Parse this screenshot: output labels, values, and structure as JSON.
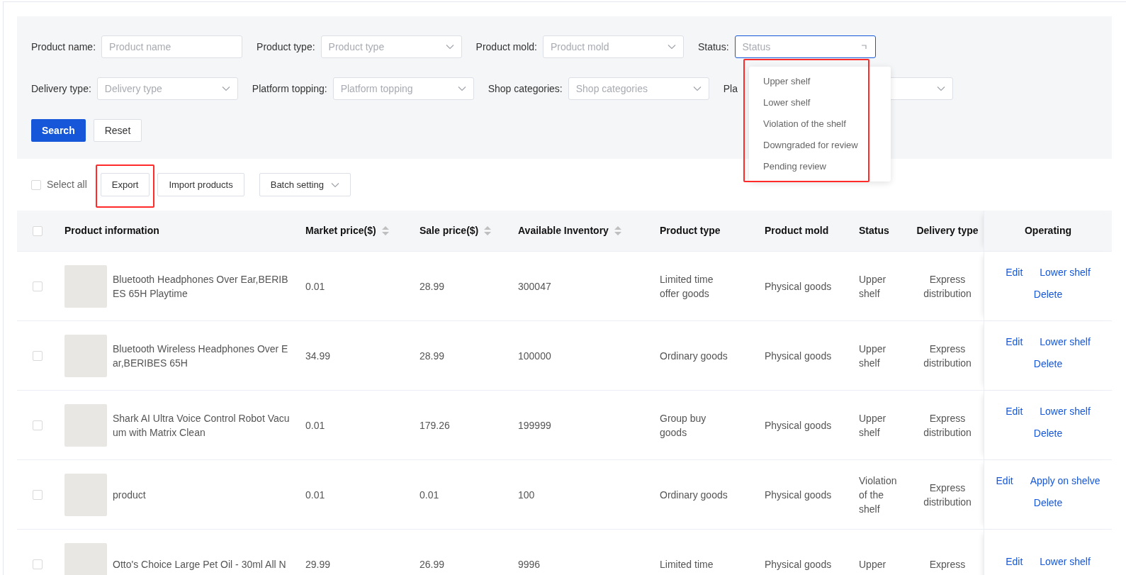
{
  "filters": [
    {
      "kind": "input",
      "label": "Product name:",
      "placeholder": "Product name",
      "focused": false
    },
    {
      "kind": "select",
      "label": "Product type:",
      "placeholder": "Product type",
      "focused": false
    },
    {
      "kind": "select",
      "label": "Product mold:",
      "placeholder": "Product mold",
      "focused": false
    },
    {
      "kind": "select",
      "label": "Status:",
      "placeholder": "Status",
      "focused": true
    },
    {
      "kind": "select",
      "label": "Delivery type:",
      "placeholder": "Delivery type",
      "focused": false
    },
    {
      "kind": "select",
      "label": "Platform topping:",
      "placeholder": "Platform topping",
      "focused": false
    },
    {
      "kind": "select",
      "label": "Shop categories:",
      "placeholder": "Shop categories",
      "focused": false
    },
    {
      "kind": "select",
      "label": "Pla",
      "focused": false
    }
  ],
  "filter_buttons": [
    {
      "label": "Search",
      "kind": "primary"
    },
    {
      "label": "Reset",
      "kind": "default"
    }
  ],
  "status_dropdown": {
    "highlighted": true,
    "options": [
      "Upper shelf",
      "Lower shelf",
      "Violation of the shelf",
      "Downgraded for review",
      "Pending review"
    ]
  },
  "toolbar": {
    "select_all": {
      "label": "Select all",
      "checked": false
    },
    "buttons": [
      {
        "label": "Export",
        "kind": "button",
        "highlighted": true
      },
      {
        "label": "Import products",
        "kind": "button",
        "highlighted": false
      },
      {
        "label": "Batch setting",
        "kind": "menu",
        "highlighted": false
      }
    ]
  },
  "table": {
    "header_checked": false,
    "columns": [
      {
        "label": "Product information",
        "sortable": false
      },
      {
        "label": "Market price($)",
        "sortable": true
      },
      {
        "label": "Sale price($)",
        "sortable": true
      },
      {
        "label": "Available Inventory",
        "sortable": true
      },
      {
        "label": "Product type",
        "sortable": false
      },
      {
        "label": "Product mold",
        "sortable": false
      },
      {
        "label": "Status",
        "sortable": false
      },
      {
        "label": "Delivery type",
        "sortable": false
      },
      {
        "label": "Operating",
        "sortable": false
      }
    ],
    "rows": [
      {
        "checked": false,
        "name": "Bluetooth Headphones Over Ear,BERIBES 65H Playtime",
        "market_price": "0.01",
        "sale_price": "28.99",
        "inventory": "300047",
        "product_type": "Limited time offer goods",
        "product_mold": "Physical goods",
        "status": "Upper shelf",
        "delivery_type": "Express distribution",
        "actions": [
          "Edit",
          "Lower shelf",
          "Delete"
        ]
      },
      {
        "checked": false,
        "name": "Bluetooth Wireless Headphones Over Ear,BERIBES 65H",
        "market_price": "34.99",
        "sale_price": "28.99",
        "inventory": "100000",
        "product_type": "Ordinary goods",
        "product_mold": "Physical goods",
        "status": "Upper shelf",
        "delivery_type": "Express distribution",
        "actions": [
          "Edit",
          "Lower shelf",
          "Delete"
        ]
      },
      {
        "checked": false,
        "name": "Shark AI Ultra Voice Control Robot Vacuum with Matrix Clean",
        "market_price": "0.01",
        "sale_price": "179.26",
        "inventory": "199999",
        "product_type": "Group buy goods",
        "product_mold": "Physical goods",
        "status": "Upper shelf",
        "delivery_type": "Express distribution",
        "actions": [
          "Edit",
          "Lower shelf",
          "Delete"
        ]
      },
      {
        "checked": false,
        "name": "product",
        "market_price": "0.01",
        "sale_price": "0.01",
        "inventory": "100",
        "product_type": "Ordinary goods",
        "product_mold": "Physical goods",
        "status": "Violation of the shelf",
        "delivery_type": "Express distribution",
        "actions": [
          "Edit",
          "Apply on shelve",
          "Delete"
        ]
      },
      {
        "checked": false,
        "name": "Otto's Choice Large Pet Oil - 30ml All N",
        "market_price": "29.99",
        "sale_price": "26.99",
        "inventory": "9996",
        "product_type": "Limited time",
        "product_mold": "Physical goods",
        "status": "Upper",
        "delivery_type": "Express",
        "actions": [
          "Edit",
          "Lower shelf"
        ]
      }
    ]
  }
}
